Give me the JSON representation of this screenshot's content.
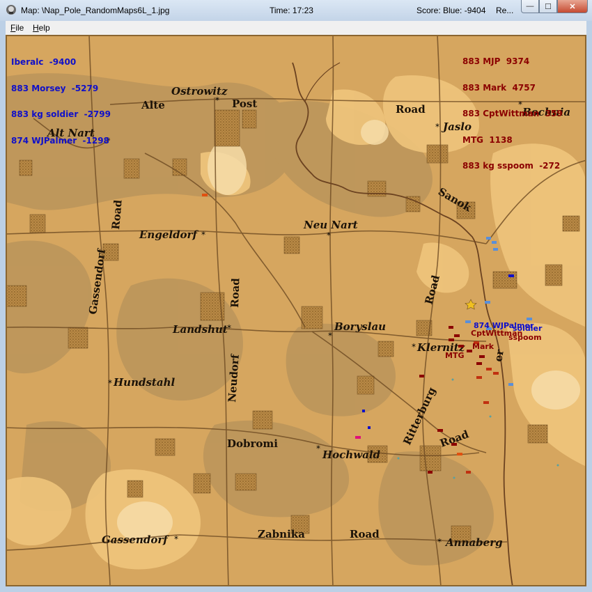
{
  "window": {
    "title": "Map: \\Nap_Pole_RandomMaps6L_1.jpg",
    "time": "Time: 17:23",
    "score": "Score: Blue: -9404",
    "truncated": "Re...",
    "min_glyph": "—",
    "max_glyph": "☐",
    "close_glyph": "✕"
  },
  "menu": {
    "file": "F",
    "file_rest": "ile",
    "help": "H",
    "help_rest": "elp"
  },
  "scoreboard": {
    "blue": [
      "Iberalc  -9400",
      "883 Morsey  -5279",
      "883 kg soldier  -2799",
      "874 WJPalmer  -1298"
    ],
    "red": [
      "883 MJP  9374",
      "883 Mark  4757",
      "883 CptWittman  359",
      "MTG  1138",
      "883 kg sspoom  -272"
    ]
  },
  "places": {
    "ostrowitz": "Ostrowitz",
    "alte": "Alte",
    "post": "Post",
    "road1": "Road",
    "bochnia": "Bochnia",
    "altnart": "Alt Nart",
    "jaslo": "Jaslo",
    "sanok": "Sanok",
    "road2": "Road",
    "engeldorf": "Engeldorf",
    "neunart": "Neu Nart",
    "gassendorf_v": "Gassendorf",
    "road3": "Road",
    "road4": "Road",
    "landshut": "Landshut",
    "boryslau": "Boryslau",
    "klernitz": "Klernitz",
    "neudorf": "Neudorf",
    "hundstahl": "Hundstahl",
    "ritterburg": "Ritterburg",
    "road5": "Road",
    "dobromi": "Dobromi",
    "hochwald": "Hochwald",
    "gassendorf": "Gassendorf",
    "zabnika": "Zabnika",
    "road6": "Road",
    "annaberg": "Annaberg",
    "river_fragment": "er"
  },
  "units": {
    "blue_label": "874 WJPalmer",
    "blue_label2": "soldier",
    "red_label1": "CptWittman",
    "red_label2": "sspoom",
    "red_label3": "Mark",
    "red_label4": "MTG"
  },
  "colors": {
    "map_base": "#d7a55c",
    "blue_team": "#1010c8",
    "red_team": "#8b0000"
  }
}
